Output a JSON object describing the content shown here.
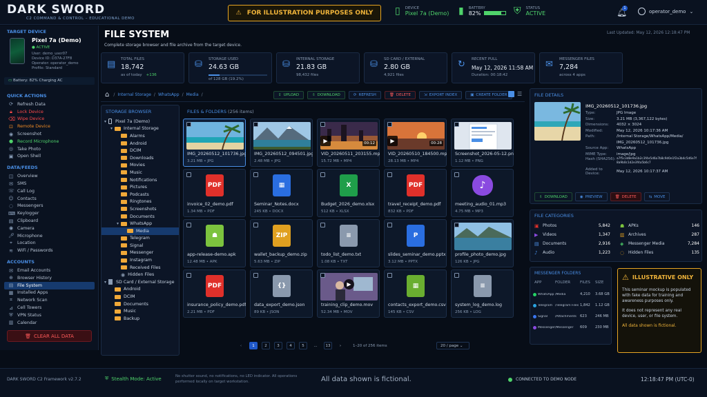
{
  "app": {
    "brand": "DARK SWORD",
    "subtitle": "C2 COMMAND & CONTROL – EDUCATIONAL DEMO",
    "warning": "FOR ILLUSTRATION PURPOSES ONLY"
  },
  "topstats": {
    "device_label": "DEVICE",
    "device_value": "Pixel 7a (Demo)",
    "battery_label": "BATTERY",
    "battery_value": "82%",
    "status_label": "STATUS",
    "status_value": "ACTIVE",
    "user": "operator_demo",
    "notif_count": "1"
  },
  "target": {
    "section": "TARGET DEVICE",
    "name": "Pixel 7a (Demo)",
    "status": "● ACTIVE",
    "lines": [
      "User: demo_user07",
      "Device ID: D37A-27F8",
      "Operator: operator_demo",
      "Profile: Standard"
    ],
    "battery": "Battery: 82% Charging AC"
  },
  "quick": {
    "section": "QUICK ACTIONS",
    "items": [
      {
        "label": "Refresh Data",
        "icon": "refresh-icon",
        "color": ""
      },
      {
        "label": "Lock Device",
        "icon": "lock-icon",
        "color": "red"
      },
      {
        "label": "Wipe Device",
        "icon": "wipe-icon",
        "color": "red"
      },
      {
        "label": "Remote Device",
        "icon": "remote-icon",
        "color": "orange"
      },
      {
        "label": "Screenshot",
        "icon": "camera-icon",
        "color": ""
      },
      {
        "label": "Record Microphone",
        "icon": "mic-icon",
        "color": "green"
      },
      {
        "label": "Take Photo",
        "icon": "photo-icon",
        "color": ""
      },
      {
        "label": "Open Shell",
        "icon": "terminal-icon",
        "color": ""
      }
    ]
  },
  "feeds": {
    "section": "DATA/FEEDS",
    "items": [
      "Overview",
      "SMS",
      "Call Log",
      "Contacts",
      "Messengers",
      "Keylogger",
      "Clipboard",
      "Camera",
      "Microphone",
      "Location",
      "WiFi / Passwords"
    ]
  },
  "accounts": {
    "section": "ACCOUNTS",
    "items": [
      "Email Accounts",
      "Browser History",
      "File System",
      "Installed Apps",
      "Network Scan",
      "Cell Towers",
      "VPN Status",
      "Calendar"
    ],
    "active_index": 2
  },
  "clear_btn": "CLEAR ALL DATA",
  "page": {
    "title": "FILE SYSTEM",
    "subtitle": "Complete storage browser and file archive from the target device.",
    "updated": "Last Updated: May 12, 2026 12:18:47 PM"
  },
  "stats": [
    {
      "label": "TOTAL FILES",
      "value": "18,742",
      "sub": "as of today",
      "sub2": "+136"
    },
    {
      "label": "STORAGE USED",
      "value": "24.63 GB",
      "sub": "of 128 GB (19.2%)",
      "progress": 0.192
    },
    {
      "label": "INTERNAL STORAGE",
      "value": "21.83 GB",
      "sub": "98,432 files"
    },
    {
      "label": "SD CARD / EXTERNAL",
      "value": "2.80 GB",
      "sub": "4,921 files"
    },
    {
      "label": "RECENT PULL",
      "value": "May 12, 2026 11:58 AM",
      "sub": "Duration: 00:18:42"
    },
    {
      "label": "MESSENGER FILES",
      "value": "7,284",
      "sub": "across 4 apps"
    }
  ],
  "breadcrumb": [
    "Internal Storage",
    "WhatsApp",
    "Media"
  ],
  "toolbar": [
    "UPLOAD",
    "DOWNLOAD",
    "REFRESH",
    "DELETE",
    "EXPORT INDEX",
    "CREATE FOLDER"
  ],
  "tree": {
    "title": "STORAGE BROWSER",
    "items": [
      {
        "label": "Pixel 7a (Demo)",
        "lvl": 0,
        "caret": "▾",
        "icon": "phone"
      },
      {
        "label": "Internal Storage",
        "lvl": 1,
        "caret": "▾",
        "icon": "folder"
      },
      {
        "label": "Alarms",
        "lvl": 2
      },
      {
        "label": "Android",
        "lvl": 2
      },
      {
        "label": "DCIM",
        "lvl": 2
      },
      {
        "label": "Downloads",
        "lvl": 2
      },
      {
        "label": "Movies",
        "lvl": 2
      },
      {
        "label": "Music",
        "lvl": 2
      },
      {
        "label": "Notifications",
        "lvl": 2
      },
      {
        "label": "Pictures",
        "lvl": 2
      },
      {
        "label": "Podcasts",
        "lvl": 2
      },
      {
        "label": "Ringtones",
        "lvl": 2
      },
      {
        "label": "Screenshots",
        "lvl": 2
      },
      {
        "label": "Documents",
        "lvl": 2
      },
      {
        "label": "WhatsApp",
        "lvl": 2,
        "caret": "▾"
      },
      {
        "label": "Media",
        "lvl": 3,
        "sel": true
      },
      {
        "label": "Telegram",
        "lvl": 2
      },
      {
        "label": "Signal",
        "lvl": 2
      },
      {
        "label": "Messenger",
        "lvl": 2
      },
      {
        "label": "Instagram",
        "lvl": 2
      },
      {
        "label": "Received Files",
        "lvl": 2
      },
      {
        "label": "Hidden Files",
        "lvl": 2,
        "icon": "eye"
      },
      {
        "label": "SD Card / External Storage",
        "lvl": 0,
        "caret": "▾",
        "icon": "sd"
      },
      {
        "label": "Android",
        "lvl": 1
      },
      {
        "label": "DCIM",
        "lvl": 1
      },
      {
        "label": "Documents",
        "lvl": 1
      },
      {
        "label": "Music",
        "lvl": 1
      },
      {
        "label": "Backup",
        "lvl": 1
      }
    ]
  },
  "files": {
    "title": "FILES & FOLDERS",
    "count": "(256 items)",
    "items": [
      {
        "name": "IMG_20260512_101736.jpg",
        "meta": "3.21 MB  •  JPG",
        "kind": "photo-beach",
        "sel": true
      },
      {
        "name": "IMG_20260512_094501.jpg",
        "meta": "2.48 MB  •  JPG",
        "kind": "photo-mountain"
      },
      {
        "name": "VID_20260511_203155.mp4",
        "meta": "15.72 MB  •  MP4",
        "kind": "video-city",
        "dur": "00:12"
      },
      {
        "name": "VID_20260510_184500.mp4",
        "meta": "28.13 MB  •  MP4",
        "kind": "video-sunset",
        "dur": "00:28"
      },
      {
        "name": "Screenshot_2026-05-12.png",
        "meta": "1.12 MB  •  PNG",
        "kind": "screenshot"
      },
      {
        "name": "invoice_02_demo.pdf",
        "meta": "1.34 MB  •  PDF",
        "kind": "pdf"
      },
      {
        "name": "Seminar_Notes.docx",
        "meta": "245 KB  •  DOCX",
        "kind": "docx"
      },
      {
        "name": "Budget_2026_demo.xlsx",
        "meta": "512 KB  •  XLSX",
        "kind": "xlsx"
      },
      {
        "name": "travel_receipt_demo.pdf",
        "meta": "832 KB  •  PDF",
        "kind": "pdf"
      },
      {
        "name": "meeting_audio_01.mp3",
        "meta": "4.75 MB  •  MP3",
        "kind": "mp3"
      },
      {
        "name": "app-release-demo.apk",
        "meta": "12.48 MB  •  APK",
        "kind": "apk"
      },
      {
        "name": "wallet_backup_demo.zip",
        "meta": "5.63 MB  •  ZIP",
        "kind": "zip"
      },
      {
        "name": "todo_list_demo.txt",
        "meta": "1.08 KB  •  TXT",
        "kind": "txt"
      },
      {
        "name": "slides_seminar_demo.pptx",
        "meta": "3.12 MB  •  PPTX",
        "kind": "pptx"
      },
      {
        "name": "profile_photo_demo.jpg",
        "meta": "126 KB  •  JPG",
        "kind": "photo-lake"
      },
      {
        "name": "insurance_policy_demo.pdf",
        "meta": "2.21 MB  •  PDF",
        "kind": "pdf"
      },
      {
        "name": "data_export_demo.json",
        "meta": "89 KB  •  JSON",
        "kind": "json"
      },
      {
        "name": "training_clip_demo.mov",
        "meta": "52.34 MB  •  MOV",
        "kind": "mov"
      },
      {
        "name": "contacts_export_demo.csv",
        "meta": "145 KB  •  CSV",
        "kind": "csv"
      },
      {
        "name": "system_log_demo.log",
        "meta": "256 KB  •  LOG",
        "kind": "log"
      }
    ]
  },
  "pager": {
    "pages": [
      "1",
      "2",
      "3",
      "4",
      "5",
      "...",
      "13"
    ],
    "range": "1–20 of 256 items",
    "per_page": "20 / page"
  },
  "details": {
    "title": "FILE DETAILS",
    "filename": "IMG_20260512_101736.jpg",
    "rows": [
      [
        "Type:",
        "JPG Image"
      ],
      [
        "Size:",
        "3.21 MB (3,367,122 bytes)"
      ],
      [
        "Dimensions:",
        "4032 × 3024"
      ],
      [
        "Modified:",
        "May 12, 2026 10:17:36 AM"
      ],
      [
        "Path:",
        "/Internal Storage/WhatsApp/Media/"
      ],
      [
        "",
        "IMG_20260512_101736.jpg"
      ],
      [
        "Source App:",
        "WhatsApp"
      ],
      [
        "MIME Type:",
        "image/jpg"
      ],
      [
        "Hash (SHA256):",
        "a7f5c3d8e9a1b2c3f4e5d6a7b8c9d0e1f2a3b4c5d6e7f8a9b0c1d2e3f4a5b6c7"
      ],
      [
        "Added to Device:",
        "May 12, 2026 10:17:37 AM"
      ]
    ],
    "buttons": [
      "DOWNLOAD",
      "PREVIEW",
      "DELETE",
      "MOVE"
    ]
  },
  "categories": {
    "title": "FILE CATEGORIES",
    "left": [
      [
        "Photos",
        "5,842"
      ],
      [
        "Videos",
        "1,347"
      ],
      [
        "Documents",
        "2,916"
      ],
      [
        "Audio",
        "1,223"
      ]
    ],
    "right": [
      [
        "APKs",
        "146"
      ],
      [
        "Archives",
        "287"
      ],
      [
        "Messenger Media",
        "7,284"
      ],
      [
        "Hidden Files",
        "135"
      ]
    ]
  },
  "messenger": {
    "title": "MESSENGER FOLDERS",
    "headers": [
      "APP",
      "FOLDER",
      "FILES",
      "SIZE"
    ],
    "rows": [
      [
        "WhatsApp",
        "/Media",
        "4,210",
        "3.68 GB"
      ],
      [
        "Telegram",
        "/Telegram Files",
        "1,842",
        "1.12 GB"
      ],
      [
        "Signal",
        "/Attachments",
        "623",
        "246 MB"
      ],
      [
        "Messenger",
        "/Messenger",
        "609",
        "230 MB"
      ]
    ]
  },
  "notice": {
    "title": "ILLUSTRATIVE ONLY",
    "p1": "This seminar mockup is populated with fake data for training and awareness purposes only.",
    "p2": "It does not represent any real device, user, or file system.",
    "p3": "All data shown is fictional."
  },
  "footer": {
    "version": "DARK SWORD C2 Framework v2.7.2",
    "stealth": "Stealth Mode: Active",
    "stealth_note": "No shutter sound, no notifications, no LED indicator. All operations performed locally on target workstation.",
    "center": "All data shown is fictional.",
    "connected": "CONNECTED TO DEMO NODE",
    "time": "12:18:47 PM (UTC-0)"
  }
}
